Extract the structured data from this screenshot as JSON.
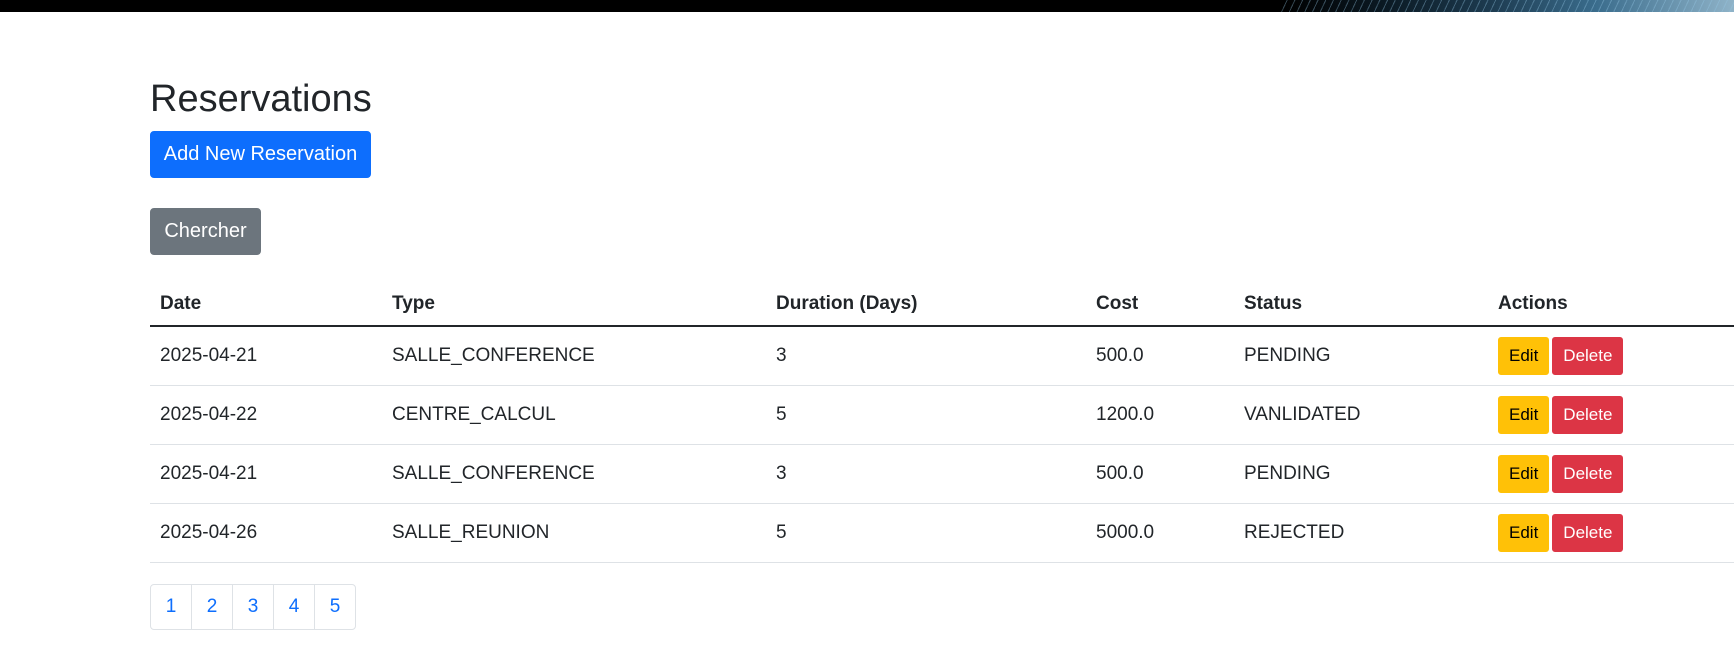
{
  "page": {
    "title": "Reservations"
  },
  "toolbar": {
    "add_label": "Add New Reservation",
    "search_label": "Chercher"
  },
  "table": {
    "headers": [
      "Date",
      "Type",
      "Duration (Days)",
      "Cost",
      "Status",
      "Actions"
    ],
    "rows": [
      {
        "date": "2025-04-21",
        "type": "SALLE_CONFERENCE",
        "duration": "3",
        "cost": "500.0",
        "status": "PENDING",
        "edit": "Edit",
        "delete": "Delete"
      },
      {
        "date": "2025-04-22",
        "type": "CENTRE_CALCUL",
        "duration": "5",
        "cost": "1200.0",
        "status": "VANLIDATED",
        "edit": "Edit",
        "delete": "Delete"
      },
      {
        "date": "2025-04-21",
        "type": "SALLE_CONFERENCE",
        "duration": "3",
        "cost": "500.0",
        "status": "PENDING",
        "edit": "Edit",
        "delete": "Delete"
      },
      {
        "date": "2025-04-26",
        "type": "SALLE_REUNION",
        "duration": "5",
        "cost": "5000.0",
        "status": "REJECTED",
        "edit": "Edit",
        "delete": "Delete"
      }
    ]
  },
  "pagination": {
    "pages": [
      "1",
      "2",
      "3",
      "4",
      "5"
    ]
  },
  "colors": {
    "primary": "#0d6efd",
    "secondary": "#6c757d",
    "warning": "#ffc107",
    "danger": "#dc3545"
  }
}
